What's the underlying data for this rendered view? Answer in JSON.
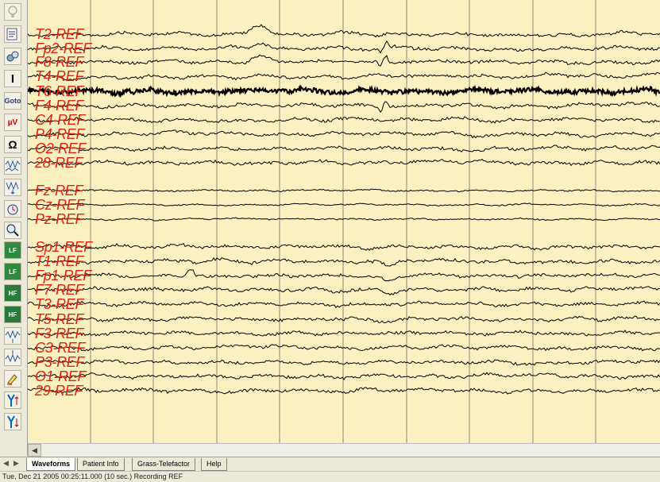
{
  "toolbar": {
    "buttons": [
      {
        "name": "lightbulb-icon",
        "glyph": ""
      },
      {
        "name": "montage-edit-icon",
        "glyph": ""
      },
      {
        "name": "filter-settings-icon",
        "glyph": ""
      },
      {
        "name": "cursor-icon",
        "glyph": "I"
      },
      {
        "name": "goto-button",
        "glyph": "Goto"
      },
      {
        "name": "sensitivity-icon",
        "glyph": "µV"
      },
      {
        "name": "impedance-icon",
        "glyph": "Ω"
      },
      {
        "name": "waveform-compress-icon",
        "glyph": ""
      },
      {
        "name": "waveform-expand-icon",
        "glyph": ""
      },
      {
        "name": "timer-icon",
        "glyph": ""
      },
      {
        "name": "zoom-icon",
        "glyph": ""
      },
      {
        "name": "lf-increase-icon",
        "glyph": "LF"
      },
      {
        "name": "lf-decrease-icon",
        "glyph": "LF"
      },
      {
        "name": "hf-increase-icon",
        "glyph": "HF"
      },
      {
        "name": "hf-decrease-icon",
        "glyph": "HF"
      },
      {
        "name": "gain-up-icon",
        "glyph": ""
      },
      {
        "name": "gain-down-icon",
        "glyph": ""
      },
      {
        "name": "marker-icon",
        "glyph": ""
      },
      {
        "name": "montage-up-icon",
        "glyph": ""
      },
      {
        "name": "montage-down-icon",
        "glyph": ""
      }
    ]
  },
  "eeg": {
    "channels": [
      "T2-REF",
      "Fp2-REF",
      "F8-REF",
      "T4-REF",
      "T6-REF",
      "F4-REF",
      "C4-REF",
      "P4-REF",
      "O2-REF",
      "28-REF",
      "Fz-REF",
      "Cz-REF",
      "Pz-REF",
      "Sp1-REF",
      "T1-REF",
      "Fp1-REF",
      "F7-REF",
      "T3-REF",
      "T5-REF",
      "F3-REF",
      "C3-REF",
      "P3-REF",
      "O1-REF",
      "29-REF"
    ],
    "label_color": "#e02010",
    "trace_color": "#000000",
    "background_color": "#fbf0c0",
    "epoch_seconds": 10
  },
  "tabs": [
    "Waveforms",
    "Patient Info",
    "Grass-Telefactor",
    "Help"
  ],
  "active_tab": "Waveforms",
  "status": {
    "text": "Tue, Dec 21 2005  00:25:11.000 (10 sec.) Recording REF"
  }
}
